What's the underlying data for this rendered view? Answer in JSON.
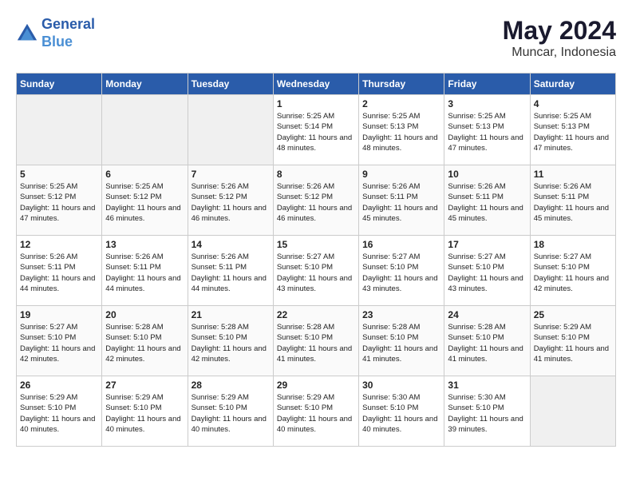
{
  "header": {
    "logo_line1": "General",
    "logo_line2": "Blue",
    "month": "May 2024",
    "location": "Muncar, Indonesia"
  },
  "days_of_week": [
    "Sunday",
    "Monday",
    "Tuesday",
    "Wednesday",
    "Thursday",
    "Friday",
    "Saturday"
  ],
  "weeks": [
    [
      {
        "day": "",
        "empty": true
      },
      {
        "day": "",
        "empty": true
      },
      {
        "day": "",
        "empty": true
      },
      {
        "day": "1",
        "sunrise": "Sunrise: 5:25 AM",
        "sunset": "Sunset: 5:14 PM",
        "daylight": "Daylight: 11 hours and 48 minutes."
      },
      {
        "day": "2",
        "sunrise": "Sunrise: 5:25 AM",
        "sunset": "Sunset: 5:13 PM",
        "daylight": "Daylight: 11 hours and 48 minutes."
      },
      {
        "day": "3",
        "sunrise": "Sunrise: 5:25 AM",
        "sunset": "Sunset: 5:13 PM",
        "daylight": "Daylight: 11 hours and 47 minutes."
      },
      {
        "day": "4",
        "sunrise": "Sunrise: 5:25 AM",
        "sunset": "Sunset: 5:13 PM",
        "daylight": "Daylight: 11 hours and 47 minutes."
      }
    ],
    [
      {
        "day": "5",
        "sunrise": "Sunrise: 5:25 AM",
        "sunset": "Sunset: 5:12 PM",
        "daylight": "Daylight: 11 hours and 47 minutes."
      },
      {
        "day": "6",
        "sunrise": "Sunrise: 5:25 AM",
        "sunset": "Sunset: 5:12 PM",
        "daylight": "Daylight: 11 hours and 46 minutes."
      },
      {
        "day": "7",
        "sunrise": "Sunrise: 5:26 AM",
        "sunset": "Sunset: 5:12 PM",
        "daylight": "Daylight: 11 hours and 46 minutes."
      },
      {
        "day": "8",
        "sunrise": "Sunrise: 5:26 AM",
        "sunset": "Sunset: 5:12 PM",
        "daylight": "Daylight: 11 hours and 46 minutes."
      },
      {
        "day": "9",
        "sunrise": "Sunrise: 5:26 AM",
        "sunset": "Sunset: 5:11 PM",
        "daylight": "Daylight: 11 hours and 45 minutes."
      },
      {
        "day": "10",
        "sunrise": "Sunrise: 5:26 AM",
        "sunset": "Sunset: 5:11 PM",
        "daylight": "Daylight: 11 hours and 45 minutes."
      },
      {
        "day": "11",
        "sunrise": "Sunrise: 5:26 AM",
        "sunset": "Sunset: 5:11 PM",
        "daylight": "Daylight: 11 hours and 45 minutes."
      }
    ],
    [
      {
        "day": "12",
        "sunrise": "Sunrise: 5:26 AM",
        "sunset": "Sunset: 5:11 PM",
        "daylight": "Daylight: 11 hours and 44 minutes."
      },
      {
        "day": "13",
        "sunrise": "Sunrise: 5:26 AM",
        "sunset": "Sunset: 5:11 PM",
        "daylight": "Daylight: 11 hours and 44 minutes."
      },
      {
        "day": "14",
        "sunrise": "Sunrise: 5:26 AM",
        "sunset": "Sunset: 5:11 PM",
        "daylight": "Daylight: 11 hours and 44 minutes."
      },
      {
        "day": "15",
        "sunrise": "Sunrise: 5:27 AM",
        "sunset": "Sunset: 5:10 PM",
        "daylight": "Daylight: 11 hours and 43 minutes."
      },
      {
        "day": "16",
        "sunrise": "Sunrise: 5:27 AM",
        "sunset": "Sunset: 5:10 PM",
        "daylight": "Daylight: 11 hours and 43 minutes."
      },
      {
        "day": "17",
        "sunrise": "Sunrise: 5:27 AM",
        "sunset": "Sunset: 5:10 PM",
        "daylight": "Daylight: 11 hours and 43 minutes."
      },
      {
        "day": "18",
        "sunrise": "Sunrise: 5:27 AM",
        "sunset": "Sunset: 5:10 PM",
        "daylight": "Daylight: 11 hours and 42 minutes."
      }
    ],
    [
      {
        "day": "19",
        "sunrise": "Sunrise: 5:27 AM",
        "sunset": "Sunset: 5:10 PM",
        "daylight": "Daylight: 11 hours and 42 minutes."
      },
      {
        "day": "20",
        "sunrise": "Sunrise: 5:28 AM",
        "sunset": "Sunset: 5:10 PM",
        "daylight": "Daylight: 11 hours and 42 minutes."
      },
      {
        "day": "21",
        "sunrise": "Sunrise: 5:28 AM",
        "sunset": "Sunset: 5:10 PM",
        "daylight": "Daylight: 11 hours and 42 minutes."
      },
      {
        "day": "22",
        "sunrise": "Sunrise: 5:28 AM",
        "sunset": "Sunset: 5:10 PM",
        "daylight": "Daylight: 11 hours and 41 minutes."
      },
      {
        "day": "23",
        "sunrise": "Sunrise: 5:28 AM",
        "sunset": "Sunset: 5:10 PM",
        "daylight": "Daylight: 11 hours and 41 minutes."
      },
      {
        "day": "24",
        "sunrise": "Sunrise: 5:28 AM",
        "sunset": "Sunset: 5:10 PM",
        "daylight": "Daylight: 11 hours and 41 minutes."
      },
      {
        "day": "25",
        "sunrise": "Sunrise: 5:29 AM",
        "sunset": "Sunset: 5:10 PM",
        "daylight": "Daylight: 11 hours and 41 minutes."
      }
    ],
    [
      {
        "day": "26",
        "sunrise": "Sunrise: 5:29 AM",
        "sunset": "Sunset: 5:10 PM",
        "daylight": "Daylight: 11 hours and 40 minutes."
      },
      {
        "day": "27",
        "sunrise": "Sunrise: 5:29 AM",
        "sunset": "Sunset: 5:10 PM",
        "daylight": "Daylight: 11 hours and 40 minutes."
      },
      {
        "day": "28",
        "sunrise": "Sunrise: 5:29 AM",
        "sunset": "Sunset: 5:10 PM",
        "daylight": "Daylight: 11 hours and 40 minutes."
      },
      {
        "day": "29",
        "sunrise": "Sunrise: 5:29 AM",
        "sunset": "Sunset: 5:10 PM",
        "daylight": "Daylight: 11 hours and 40 minutes."
      },
      {
        "day": "30",
        "sunrise": "Sunrise: 5:30 AM",
        "sunset": "Sunset: 5:10 PM",
        "daylight": "Daylight: 11 hours and 40 minutes."
      },
      {
        "day": "31",
        "sunrise": "Sunrise: 5:30 AM",
        "sunset": "Sunset: 5:10 PM",
        "daylight": "Daylight: 11 hours and 39 minutes."
      },
      {
        "day": "",
        "empty": true
      }
    ]
  ]
}
